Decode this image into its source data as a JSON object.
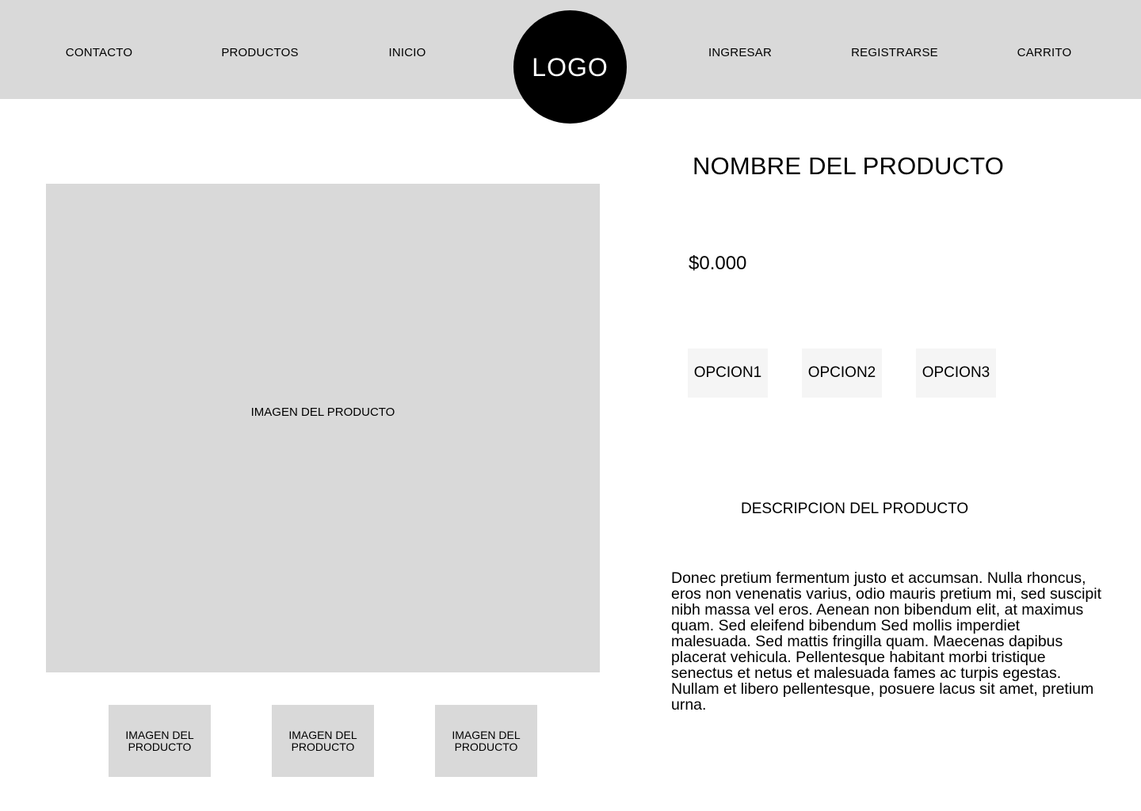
{
  "header": {
    "nav_left": [
      "CONTACTO",
      "PRODUCTOS",
      "INICIO"
    ],
    "logo": "LOGO",
    "nav_right": [
      "INGRESAR",
      "REGISTRARSE",
      "CARRITO"
    ]
  },
  "gallery": {
    "main_image_label": "IMAGEN DEL PRODUCTO",
    "thumbnails": [
      "IMAGEN DEL PRODUCTO",
      "IMAGEN DEL PRODUCTO",
      "IMAGEN DEL PRODUCTO"
    ]
  },
  "product": {
    "name": "NOMBRE DEL PRODUCTO",
    "price": "$0.000",
    "options": [
      "OPCION1",
      "OPCION2",
      "OPCION3"
    ],
    "description_title": "DESCRIPCION DEL PRODUCTO",
    "description": "Donec pretium fermentum justo et accumsan. Nulla rhoncus, eros non venenatis varius, odio mauris pretium mi, sed suscipit nibh massa vel eros. Aenean non bibendum elit, at maximus quam. Sed eleifend bibendum Sed mollis imperdiet malesuada. Sed mattis fringilla quam. Maecenas dapibus placerat vehicula. Pellentesque habitant morbi tristique senectus et netus et malesuada fames ac turpis egestas. Nullam et libero pellentesque, posuere lacus sit amet, pretium urna."
  },
  "colors": {
    "header_bg": "#d9d9d9",
    "image_placeholder": "#d9d9d9",
    "option_bg": "#f5f5f5",
    "logo_bg": "#000000"
  }
}
